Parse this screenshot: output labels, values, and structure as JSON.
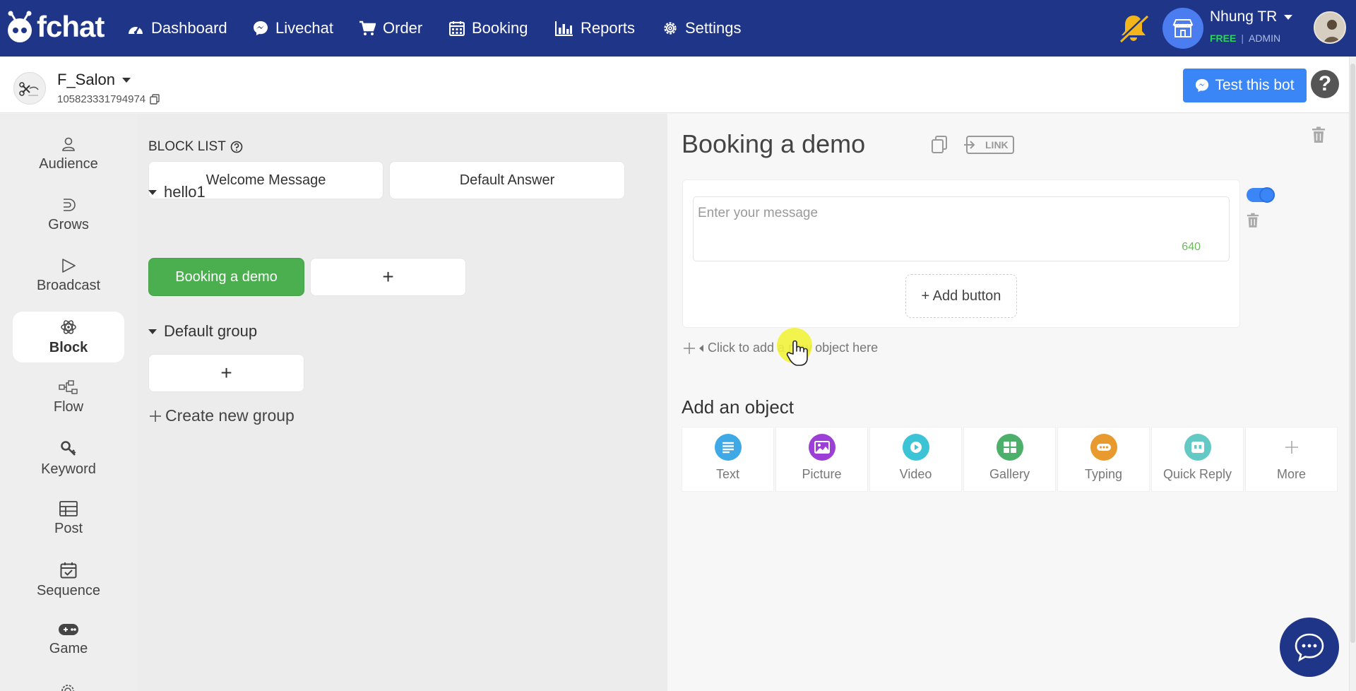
{
  "brand": {
    "name": "fchat"
  },
  "nav": {
    "items": [
      {
        "label": "Dashboard",
        "icon": "dashboard-icon"
      },
      {
        "label": "Livechat",
        "icon": "messenger-icon"
      },
      {
        "label": "Order",
        "icon": "cart-icon"
      },
      {
        "label": "Booking",
        "icon": "calendar-icon"
      },
      {
        "label": "Reports",
        "icon": "bar-chart-icon"
      },
      {
        "label": "Settings",
        "icon": "gear-icon"
      }
    ]
  },
  "user": {
    "name": "Nhung TR",
    "plan": "FREE",
    "separator": "|",
    "role": "ADMIN"
  },
  "page": {
    "name": "F_Salon",
    "id": "105823331794974"
  },
  "actions": {
    "test_bot": "Test this bot",
    "help": "?"
  },
  "sidebar": {
    "items": [
      {
        "label": "Audience",
        "icon": "user-icon"
      },
      {
        "label": "Grows",
        "icon": "grows-icon"
      },
      {
        "label": "Broadcast",
        "icon": "send-icon"
      },
      {
        "label": "Block",
        "icon": "atom-icon",
        "active": true
      },
      {
        "label": "Flow",
        "icon": "flow-icon"
      },
      {
        "label": "Keyword",
        "icon": "key-icon"
      },
      {
        "label": "Post",
        "icon": "post-icon"
      },
      {
        "label": "Sequence",
        "icon": "calendar-check-icon"
      },
      {
        "label": "Game",
        "icon": "gamepad-icon"
      }
    ]
  },
  "blocklist": {
    "title": "BLOCK LIST",
    "default_blocks": [
      "Welcome Message",
      "Default Answer"
    ],
    "groups": [
      {
        "name": "hello1",
        "blocks": [
          "Booking a demo"
        ],
        "add": "+"
      },
      {
        "name": "Default group",
        "blocks": [],
        "add": "+"
      }
    ],
    "create_group": "Create new group"
  },
  "editor": {
    "title": "Booking a demo",
    "link_label": "LINK",
    "message_placeholder": "Enter your message",
    "char_counter": "640",
    "add_button": "+ Add button",
    "add_hint": "Click to add a new object here",
    "add_object_title": "Add an object",
    "objects": [
      {
        "label": "Text",
        "color": "#3fa9e6",
        "icon": "text-icon"
      },
      {
        "label": "Picture",
        "color": "#9b3fd6",
        "icon": "picture-icon"
      },
      {
        "label": "Video",
        "color": "#3cc4d6",
        "icon": "video-icon"
      },
      {
        "label": "Gallery",
        "color": "#4caf6a",
        "icon": "gallery-icon"
      },
      {
        "label": "Typing",
        "color": "#e89a2e",
        "icon": "typing-icon"
      },
      {
        "label": "Quick Reply",
        "color": "#62c9c4",
        "icon": "quick-reply-icon"
      },
      {
        "label": "More",
        "color": "#aaaaaa",
        "icon": "plus-icon"
      }
    ]
  },
  "colors": {
    "topnav": "#1f3587",
    "accent": "#3a86f7",
    "active_block": "#4caf4f",
    "free_badge": "#2ad25e"
  }
}
